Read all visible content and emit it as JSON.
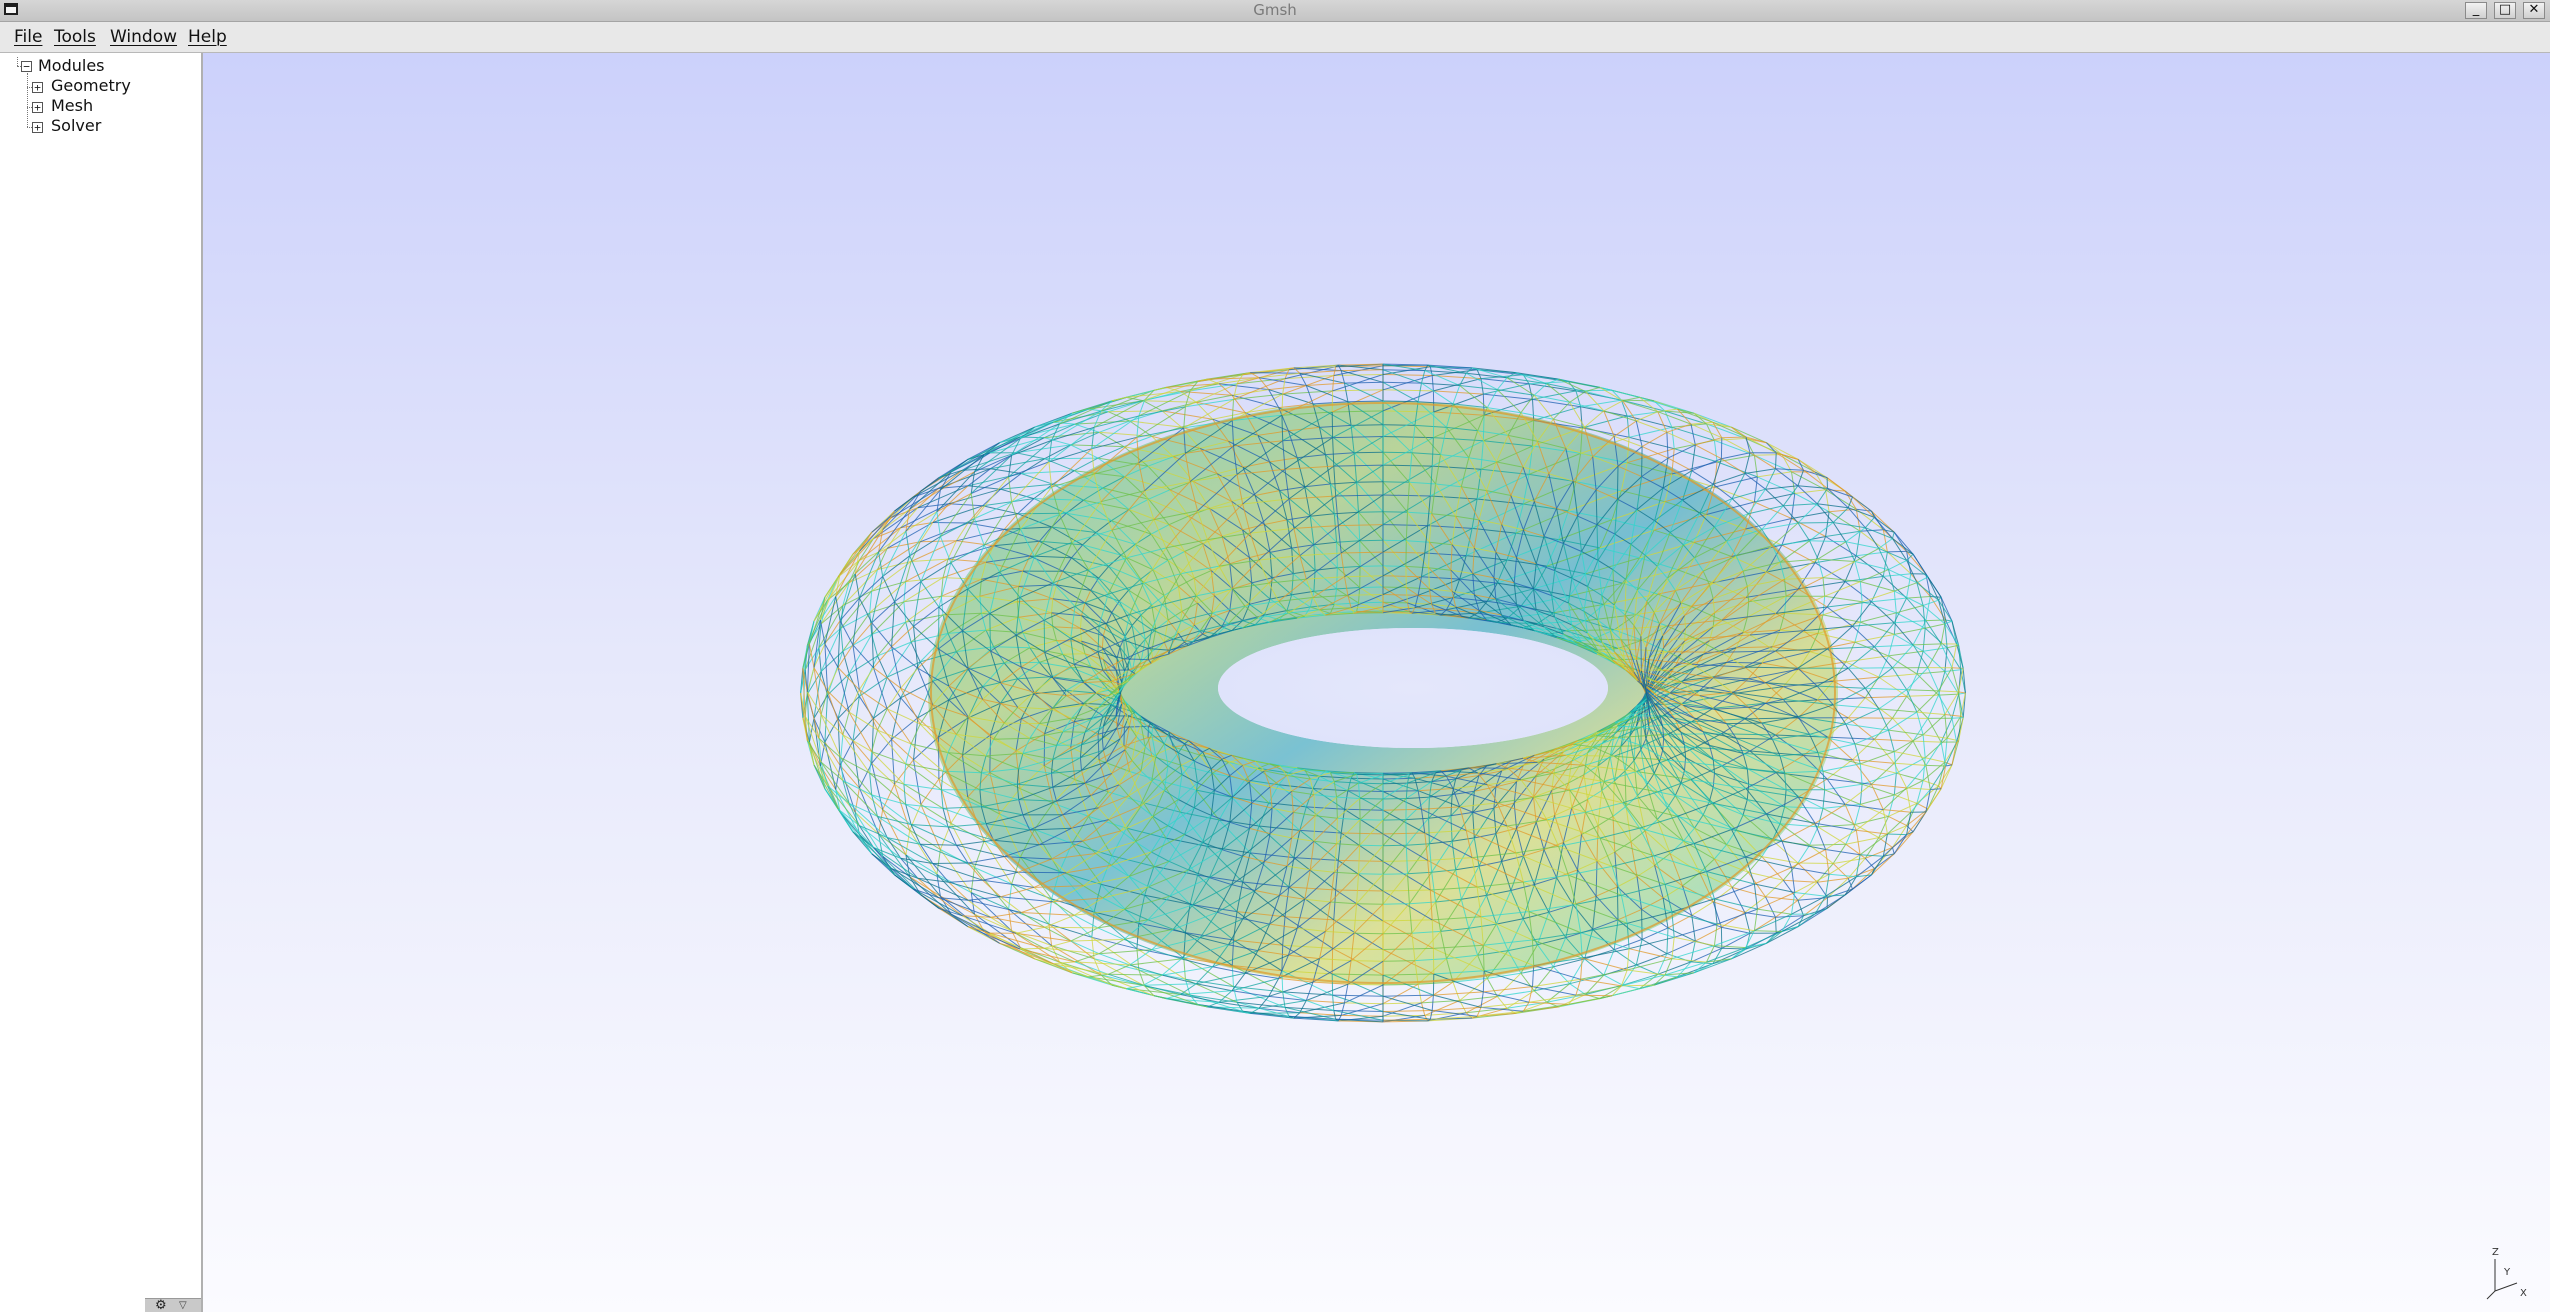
{
  "window": {
    "title": "Gmsh",
    "minimize_glyph": "_",
    "maximize_glyph": "□",
    "close_glyph": "✕"
  },
  "menu": {
    "file": "File",
    "tools": "Tools",
    "window": "Window",
    "help": "Help"
  },
  "tree": {
    "root": {
      "label": "Modules",
      "expander": "−"
    },
    "children": [
      {
        "label": "Geometry",
        "expander": "+"
      },
      {
        "label": "Mesh",
        "expander": "+"
      },
      {
        "label": "Solver",
        "expander": "+"
      }
    ]
  },
  "tools": {
    "gear_glyph": "⚙",
    "dropdown_glyph": "▽"
  },
  "viewport": {
    "background_top": "#ccd1fb",
    "background_bottom": "#fbfbff",
    "object": "torus-wireframe-mesh",
    "mesh_colors": [
      "#0a6f8a",
      "#12a6a0",
      "#2fd6cc",
      "#6cc14a",
      "#cfd63a",
      "#e09a2a",
      "#1c5fb0"
    ],
    "axes": {
      "z": "Z",
      "y": "Y",
      "x": "X"
    }
  }
}
